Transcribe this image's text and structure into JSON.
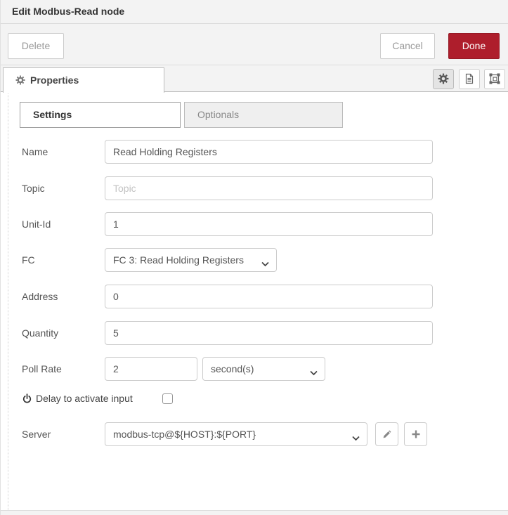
{
  "dialog": {
    "title": "Edit Modbus-Read node",
    "buttons": {
      "delete": "Delete",
      "cancel": "Cancel",
      "done": "Done"
    },
    "colors": {
      "accent_red": "#AE1E2C",
      "header_bg": "#f3f3f3",
      "border": "#cccccc",
      "inactive_tab_bg": "#efefef"
    }
  },
  "tabs": {
    "properties": "Properties"
  },
  "subtabs": {
    "settings": "Settings",
    "optionals": "Optionals"
  },
  "form": {
    "name": {
      "label": "Name",
      "value": "Read Holding Registers"
    },
    "topic": {
      "label": "Topic",
      "placeholder": "Topic"
    },
    "unit_id": {
      "label": "Unit-Id",
      "value": "1"
    },
    "fc": {
      "label": "FC",
      "selected": "FC 3: Read Holding Registers"
    },
    "address": {
      "label": "Address",
      "value": "0"
    },
    "quantity": {
      "label": "Quantity",
      "value": "5"
    },
    "poll_rate": {
      "label": "Poll Rate",
      "value": "2",
      "unit": "second(s)"
    },
    "delay": {
      "label": "Delay to activate input",
      "checked": false
    },
    "server": {
      "label": "Server",
      "selected": "modbus-tcp@${HOST}:${PORT}"
    }
  }
}
